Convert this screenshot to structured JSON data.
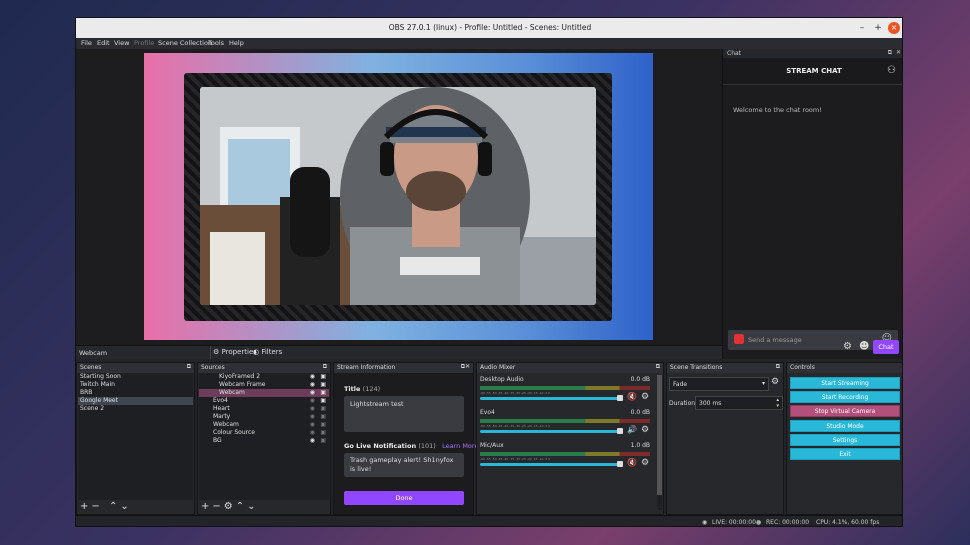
{
  "window": {
    "title": "OBS 27.0.1 (linux) - Profile: Untitled - Scenes: Untitled"
  },
  "menu": [
    "File",
    "Edit",
    "View",
    "Profile",
    "Scene Collection",
    "Tools",
    "Help"
  ],
  "chat": {
    "dock_title": "Chat",
    "header": "STREAM CHAT",
    "welcome": "Welcome to the chat room!",
    "placeholder": "Send a message",
    "chat_button": "Chat"
  },
  "scene_bar": {
    "current_scene": "Webcam",
    "properties": "Properties",
    "filters": "Filters"
  },
  "scenes": {
    "title": "Scenes",
    "items": [
      "Starting Soon",
      "Twitch Main",
      "BRB",
      "Google Meet",
      "Scene 2"
    ],
    "selected_index": 3
  },
  "sources": {
    "title": "Sources",
    "items": [
      "KiyoFramed 2",
      "Webcam Frame",
      "Webcam",
      "Evo4",
      "Heart",
      "Marty",
      "Webcam",
      "Colour Source",
      "BG"
    ],
    "selected_index": 2
  },
  "stream_info": {
    "dock_title": "Stream Information",
    "title_label": "Title",
    "title_count": "(124)",
    "title_value": "Lightstream test",
    "notif_label": "Go Live Notification",
    "notif_count": "(101)",
    "learn_more": "Learn More",
    "notif_value": "Trash gameplay alert! Sh1nyfox is live!",
    "done": "Done"
  },
  "audio": {
    "title": "Audio Mixer",
    "channels": [
      {
        "name": "Desktop Audio",
        "db": "0.0 dB",
        "volume": 1.0
      },
      {
        "name": "Evo4",
        "db": "0.0 dB",
        "volume": 1.0
      },
      {
        "name": "Mic/Aux",
        "db": "1.0 dB",
        "volume": 1.0
      }
    ],
    "ticks": "-60 -55 -50 -45 -40 -35 -30 -25 -20 -15 -10 -5 0"
  },
  "transitions": {
    "title": "Scene Transitions",
    "selected": "Fade",
    "duration_label": "Duration",
    "duration_value": "300 ms"
  },
  "controls": {
    "title": "Controls",
    "buttons": [
      "Start Streaming",
      "Start Recording",
      "Stop Virtual Camera",
      "Studio Mode",
      "Settings",
      "Exit"
    ]
  },
  "status": {
    "live": "LIVE: 00:00:00",
    "rec": "REC: 00:00:00",
    "cpu": "CPU: 4.1%, 60.00 fps"
  },
  "colors": {
    "accent": "#29b8d8",
    "chat_purple": "#9147ff",
    "selected_magenta": "#b24f7a"
  }
}
